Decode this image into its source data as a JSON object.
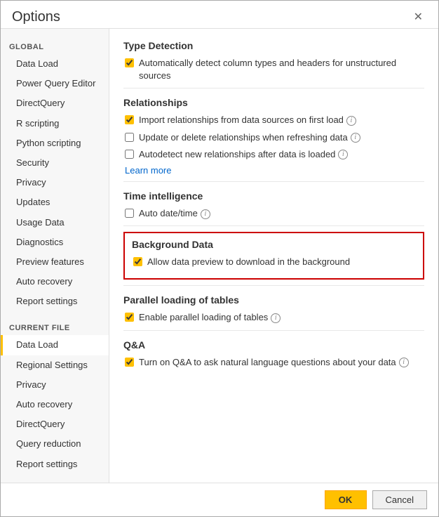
{
  "dialog": {
    "title": "Options",
    "close_label": "✕"
  },
  "footer": {
    "ok_label": "OK",
    "cancel_label": "Cancel"
  },
  "sidebar": {
    "global_label": "GLOBAL",
    "global_items": [
      {
        "label": "Data Load",
        "active": false
      },
      {
        "label": "Power Query Editor",
        "active": false
      },
      {
        "label": "DirectQuery",
        "active": false
      },
      {
        "label": "R scripting",
        "active": false
      },
      {
        "label": "Python scripting",
        "active": false
      },
      {
        "label": "Security",
        "active": false
      },
      {
        "label": "Privacy",
        "active": false
      },
      {
        "label": "Updates",
        "active": false
      },
      {
        "label": "Usage Data",
        "active": false
      },
      {
        "label": "Diagnostics",
        "active": false
      },
      {
        "label": "Preview features",
        "active": false
      },
      {
        "label": "Auto recovery",
        "active": false
      },
      {
        "label": "Report settings",
        "active": false
      }
    ],
    "current_file_label": "CURRENT FILE",
    "current_file_items": [
      {
        "label": "Data Load",
        "active": true
      },
      {
        "label": "Regional Settings",
        "active": false
      },
      {
        "label": "Privacy",
        "active": false
      },
      {
        "label": "Auto recovery",
        "active": false
      },
      {
        "label": "DirectQuery",
        "active": false
      },
      {
        "label": "Query reduction",
        "active": false
      },
      {
        "label": "Report settings",
        "active": false
      }
    ]
  },
  "main": {
    "sections": [
      {
        "title": "Type Detection",
        "items": [
          {
            "label": "Automatically detect column types and headers for unstructured sources",
            "checked": true,
            "info": false
          }
        ]
      },
      {
        "title": "Relationships",
        "items": [
          {
            "label": "Import relationships from data sources on first load",
            "checked": true,
            "info": true
          },
          {
            "label": "Update or delete relationships when refreshing data",
            "checked": false,
            "info": true
          },
          {
            "label": "Autodetect new relationships after data is loaded",
            "checked": false,
            "info": true
          }
        ],
        "learn_more": true
      },
      {
        "title": "Time intelligence",
        "items": [
          {
            "label": "Auto date/time",
            "checked": false,
            "info": true
          }
        ]
      },
      {
        "title": "Background Data",
        "highlighted": true,
        "items": [
          {
            "label": "Allow data preview to download in the background",
            "checked": true,
            "info": false
          }
        ]
      },
      {
        "title": "Parallel loading of tables",
        "items": [
          {
            "label": "Enable parallel loading of tables",
            "checked": true,
            "info": true
          }
        ]
      },
      {
        "title": "Q&A",
        "items": [
          {
            "label": "Turn on Q&A to ask natural language questions about your data",
            "checked": true,
            "info": true
          }
        ]
      }
    ]
  }
}
